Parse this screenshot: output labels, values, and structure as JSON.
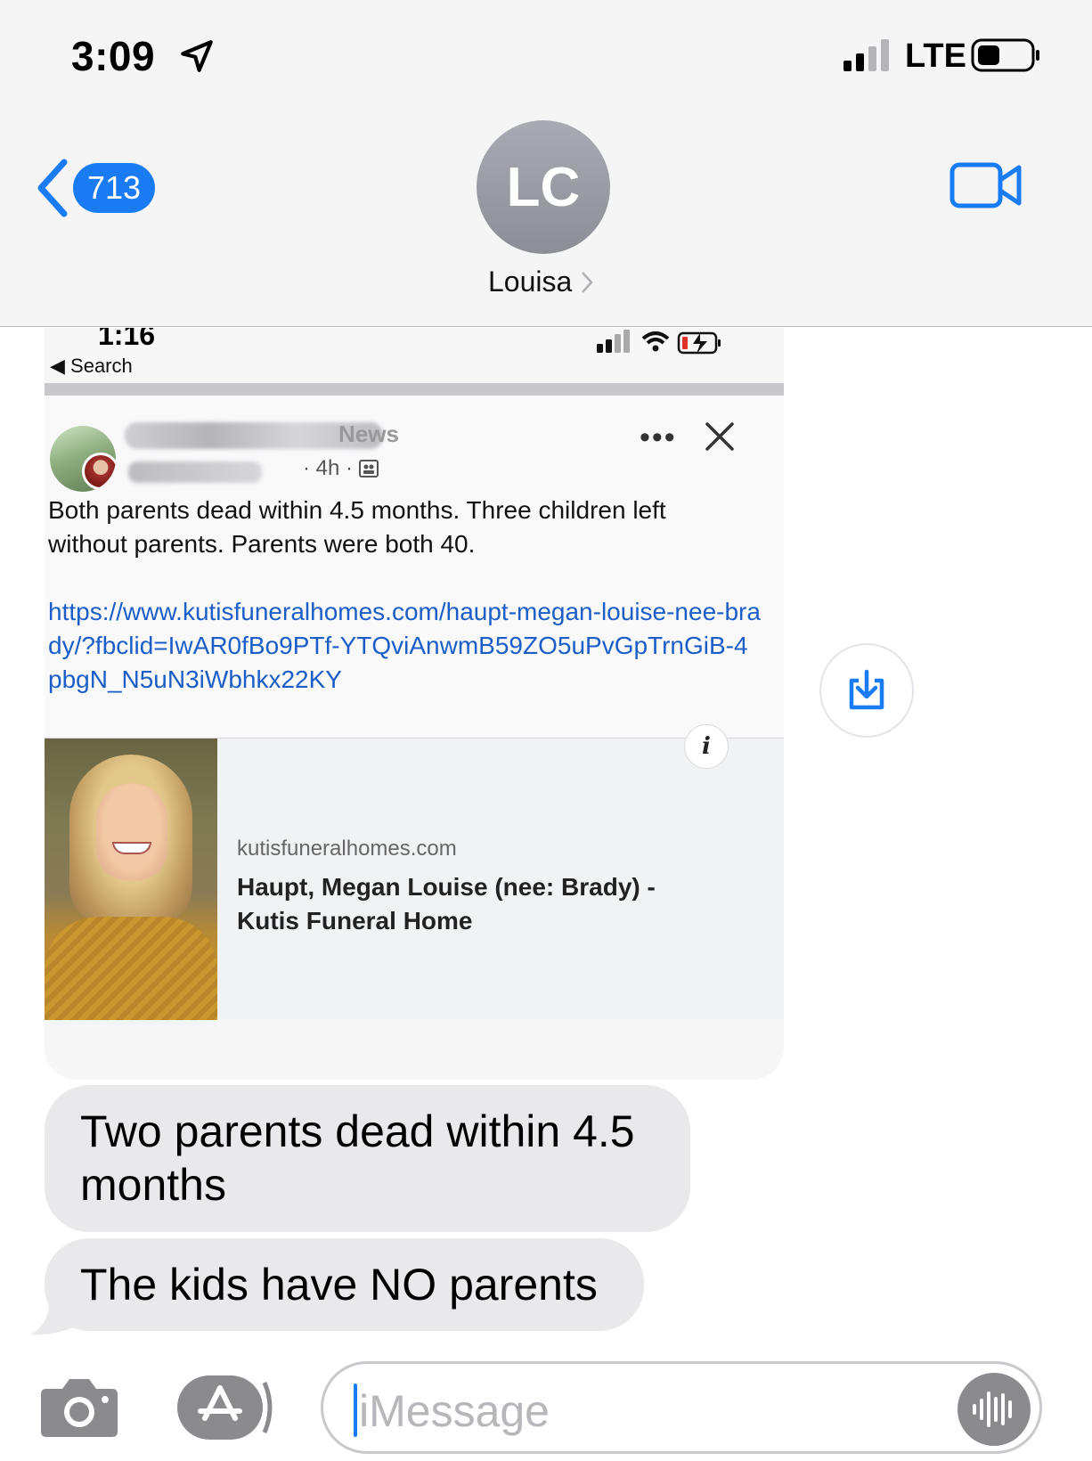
{
  "status_bar": {
    "time": "3:09",
    "network": "LTE"
  },
  "header": {
    "back_badge": "713",
    "avatar_initials": "LC",
    "contact_name": "Louisa"
  },
  "shared_screenshot": {
    "status_time": "1:16",
    "back_label": "◀ Search",
    "post": {
      "page_name_suffix": "News",
      "time_ago": "· 4h ·",
      "more_label": "•••",
      "text": "Both parents dead within 4.5 months.  Three children left without parents. Parents were both 40.",
      "link": "https://www.kutisfuneralhomes.com/haupt-megan-louise-nee-brady/?fbclid=IwAR0fBo9PTf-YTQviAnwmB59ZO5uPvGpTrnGiB-4pbgN_N5uN3iWbhkx22KY"
    },
    "link_card": {
      "info_label": "i",
      "domain": "kutisfuneralhomes.com",
      "title": "Haupt, Megan Louise (nee: Brady) - Kutis Funeral Home"
    }
  },
  "messages": [
    {
      "text": "Two parents dead within 4.5 months"
    },
    {
      "text": "The kids have NO parents"
    }
  ],
  "input": {
    "placeholder": "iMessage"
  },
  "colors": {
    "accent": "#1a7cf5",
    "bubble_received": "#e9e9eb",
    "link": "#1b5ec7"
  }
}
